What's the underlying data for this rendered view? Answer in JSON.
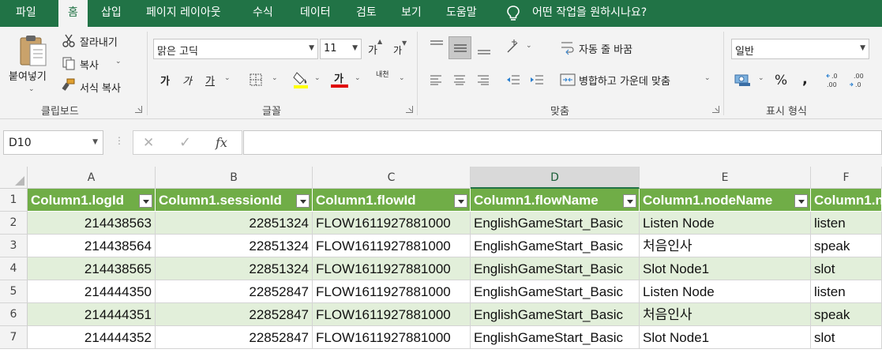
{
  "menu": {
    "tabs": [
      "파일",
      "홈",
      "삽입",
      "페이지 레이아웃",
      "수식",
      "데이터",
      "검토",
      "보기",
      "도움말"
    ],
    "active_tab": "홈",
    "tell_me": "어떤 작업을 원하시나요?"
  },
  "ribbon": {
    "clipboard": {
      "paste": "붙여넣기",
      "cut": "잘라내기",
      "copy": "복사",
      "format_painter": "서식 복사",
      "label": "클립보드"
    },
    "font": {
      "font_name": "맑은 고딕",
      "font_size": "11",
      "grow": "가",
      "shrink": "가",
      "bold": "가",
      "italic": "가",
      "underline": "가",
      "font_color_glyph": "가",
      "phonetic": "내천",
      "label": "글꼴",
      "highlight_color": "#ffff00",
      "font_color": "#e00000"
    },
    "alignment": {
      "wrap_text": "자동 줄 바꿈",
      "merge_center": "병합하고 가운데 맞춤",
      "label": "맞춤"
    },
    "number": {
      "format": "일반",
      "percent": "%",
      "comma": ",",
      "label": "표시 형식"
    }
  },
  "formula_bar": {
    "name_box": "D10",
    "cancel_glyph": "✕",
    "enter_glyph": "✓",
    "fx_glyph": "fx",
    "formula": ""
  },
  "grid": {
    "columns": [
      "A",
      "B",
      "C",
      "D",
      "E",
      "F"
    ],
    "selected_column": "D",
    "rows": [
      "1",
      "2",
      "3",
      "4",
      "5",
      "6",
      "7"
    ],
    "header_row": [
      "Column1.logId",
      "Column1.sessionId",
      "Column1.flowId",
      "Column1.flowName",
      "Column1.nodeName",
      "Column1.n"
    ],
    "data": [
      [
        "214438563",
        "22851324",
        "FLOW1611927881000",
        "EnglishGameStart_Basic",
        "Listen Node",
        "listen"
      ],
      [
        "214438564",
        "22851324",
        "FLOW1611927881000",
        "EnglishGameStart_Basic",
        "처음인사",
        "speak"
      ],
      [
        "214438565",
        "22851324",
        "FLOW1611927881000",
        "EnglishGameStart_Basic",
        "Slot Node1",
        "slot"
      ],
      [
        "214444350",
        "22852847",
        "FLOW1611927881000",
        "EnglishGameStart_Basic",
        "Listen Node",
        "listen"
      ],
      [
        "214444351",
        "22852847",
        "FLOW1611927881000",
        "EnglishGameStart_Basic",
        "처음인사",
        "speak"
      ],
      [
        "214444352",
        "22852847",
        "FLOW1611927881000",
        "EnglishGameStart_Basic",
        "Slot Node1",
        "slot"
      ]
    ],
    "colors": {
      "header": "#70ad47",
      "band": "#e2efda",
      "accent": "#217346"
    }
  }
}
